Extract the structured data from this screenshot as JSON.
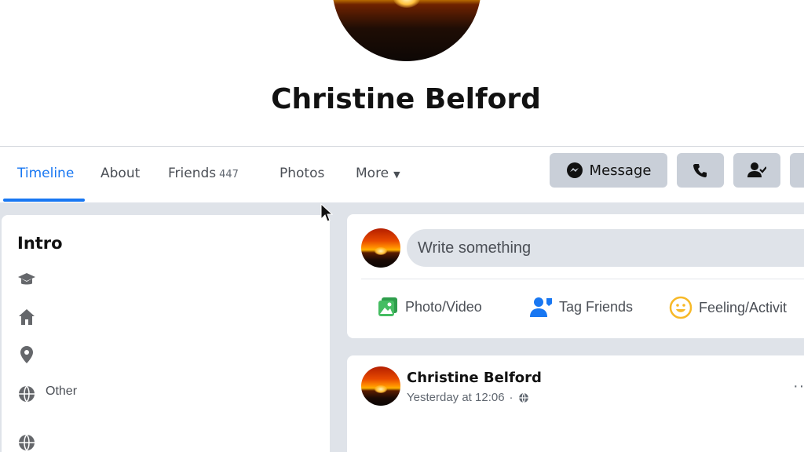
{
  "profile": {
    "name": "Christine Belford"
  },
  "nav": {
    "tabs": [
      {
        "label": "Timeline",
        "active": true
      },
      {
        "label": "About"
      },
      {
        "label": "Friends",
        "count": "447"
      },
      {
        "label": "Photos"
      },
      {
        "label": "More"
      }
    ],
    "message_label": "Message"
  },
  "intro": {
    "title": "Intro",
    "items": [
      {
        "icon": "education-icon"
      },
      {
        "icon": "home-icon"
      },
      {
        "icon": "location-pin-icon"
      },
      {
        "icon": "globe-icon",
        "label": "Other"
      },
      {
        "icon": "globe-icon"
      }
    ]
  },
  "composer": {
    "placeholder": "Write something",
    "actions": [
      {
        "label": "Photo/Video",
        "icon": "photo-icon"
      },
      {
        "label": "Tag Friends",
        "icon": "tag-friends-icon"
      },
      {
        "label": "Feeling/Activit",
        "icon": "feeling-icon"
      }
    ]
  },
  "post": {
    "author": "Christine Belford",
    "time": "Yesterday at 12:06",
    "privacy_icon": "globe-icon",
    "menu": "··"
  },
  "colors": {
    "accent": "#1877f2",
    "button_bg": "#c9cfd8",
    "feed_bg": "#dfe3e9",
    "photo_green": "#45bd62",
    "tag_blue": "#1877f2",
    "feeling_yellow": "#f7b928"
  }
}
